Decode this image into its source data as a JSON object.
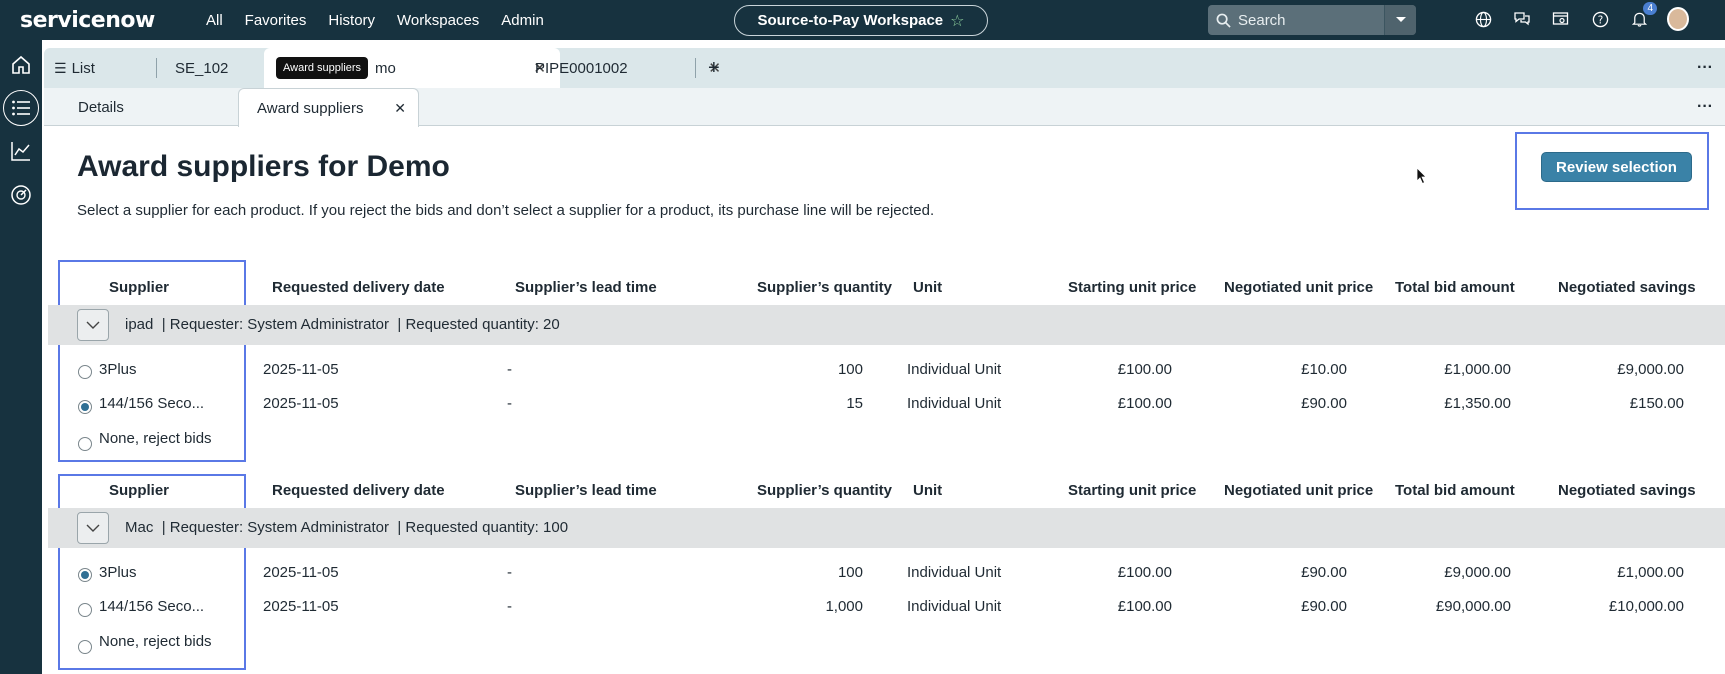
{
  "header": {
    "logo": "servicenow",
    "nav": [
      "All",
      "Favorites",
      "History",
      "Workspaces",
      "Admin"
    ],
    "workspace": "Source-to-Pay Workspace",
    "search_placeholder": "Search",
    "notification_count": "4"
  },
  "tabs": {
    "list_label": "List",
    "items": [
      {
        "label": "SE_102"
      },
      {
        "label": "mo"
      },
      {
        "label": "PIPE0001002"
      }
    ],
    "tooltip": "Award suppliers"
  },
  "subtabs": {
    "details": "Details",
    "award": "Award suppliers"
  },
  "page": {
    "title": "Award suppliers for Demo",
    "description": "Select a supplier for each product. If you reject the bids and don’t select a supplier for a product, its purchase line will be rejected.",
    "review_button": "Review selection"
  },
  "columns": [
    "Supplier",
    "Requested delivery date",
    "Supplier’s lead time",
    "Supplier’s quantity",
    "Unit",
    "Starting unit price",
    "Negotiated unit price",
    "Total bid amount",
    "Negotiated savings"
  ],
  "groups": [
    {
      "product": "ipad",
      "requester": "| Requester: System Administrator",
      "quantity": "| Requested quantity: 20",
      "rows": [
        {
          "supplier": "3Plus",
          "selected": false,
          "date": "2025-11-05",
          "lead": "-",
          "qty": "100",
          "unit": "Individual Unit",
          "start": "£100.00",
          "neg": "£10.00",
          "total": "£1,000.00",
          "savings": "£9,000.00"
        },
        {
          "supplier": "144/156 Seco...",
          "selected": true,
          "date": "2025-11-05",
          "lead": "-",
          "qty": "15",
          "unit": "Individual Unit",
          "start": "£100.00",
          "neg": "£90.00",
          "total": "£1,350.00",
          "savings": "£150.00"
        }
      ],
      "reject_label": "None, reject bids",
      "reject_selected": false
    },
    {
      "product": "Mac",
      "requester": "| Requester: System Administrator",
      "quantity": "| Requested quantity: 100",
      "rows": [
        {
          "supplier": "3Plus",
          "selected": true,
          "date": "2025-11-05",
          "lead": "-",
          "qty": "100",
          "unit": "Individual Unit",
          "start": "£100.00",
          "neg": "£90.00",
          "total": "£9,000.00",
          "savings": "£1,000.00"
        },
        {
          "supplier": "144/156 Seco...",
          "selected": false,
          "date": "2025-11-05",
          "lead": "-",
          "qty": "1,000",
          "unit": "Individual Unit",
          "start": "£100.00",
          "neg": "£90.00",
          "total": "£90,000.00",
          "savings": "£10,000.00"
        }
      ],
      "reject_label": "None, reject bids",
      "reject_selected": false
    }
  ]
}
